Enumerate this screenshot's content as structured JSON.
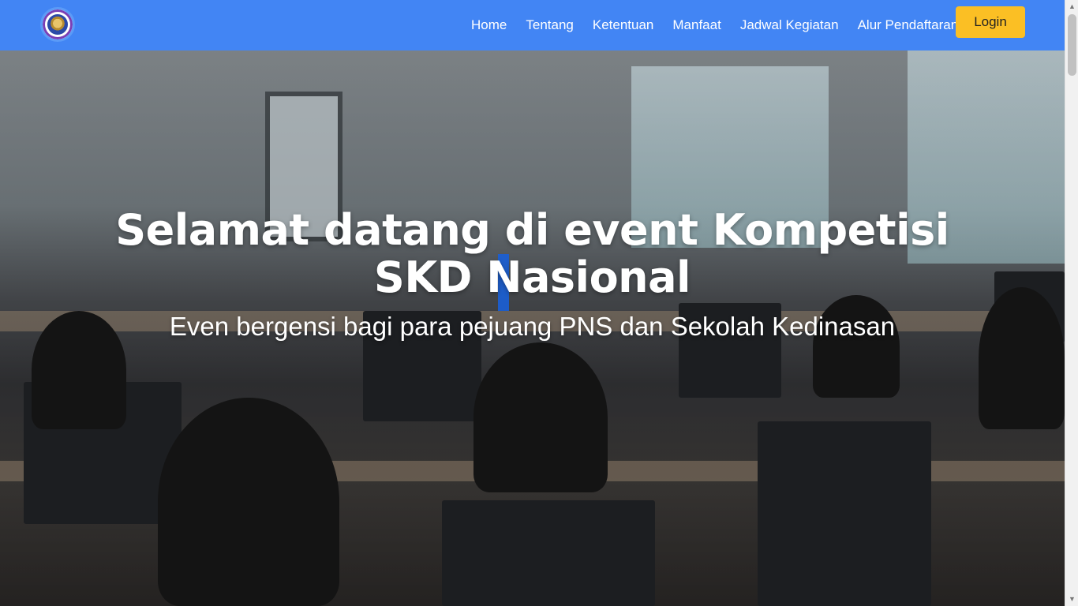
{
  "nav": {
    "logo_icon": "trophy-emblem-icon",
    "links": [
      "Home",
      "Tentang",
      "Ketentuan",
      "Manfaat",
      "Jadwal Kegiatan",
      "Alur Pendaftaran"
    ],
    "login_label": "Login"
  },
  "hero": {
    "title": "Selamat datang di event Kompetisi SKD Nasional",
    "subtitle": "Even bergensi bagi para pejuang PNS dan Sekolah Kedinasan",
    "background_image": "classroom-computer-exam-photo"
  },
  "colors": {
    "navbar": "#4285f4",
    "login_button": "#fbbf24",
    "text": "#ffffff"
  },
  "scrollbar": {
    "up_icon": "scroll-up-arrow-icon",
    "down_icon": "scroll-down-arrow-icon"
  }
}
